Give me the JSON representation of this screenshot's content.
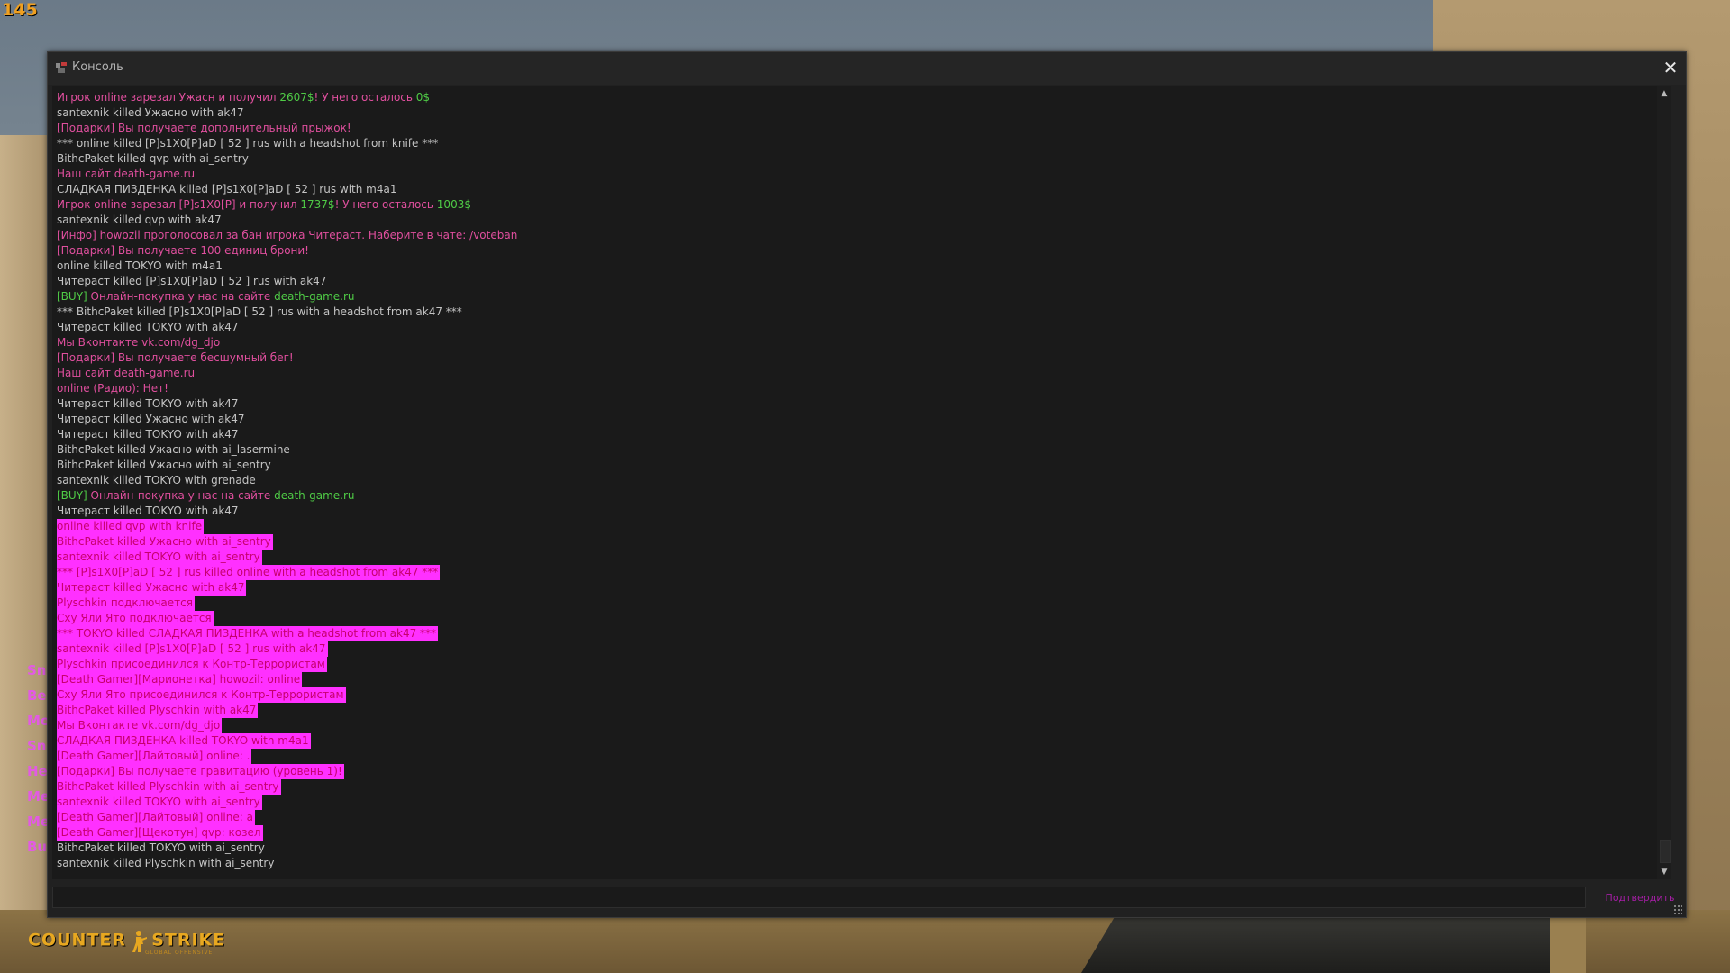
{
  "hud": {
    "fps": "145"
  },
  "side_chat": [
    "Sn",
    "Be",
    "Mo",
    "Sn",
    "He",
    "Me",
    "Me",
    "Bu"
  ],
  "console": {
    "title": "Консоль",
    "close_icon": "close-icon",
    "title_icon": "console-icon",
    "submit_label": "Подтвердить",
    "input_value": "",
    "colors": {
      "default": "#c4c4c4",
      "pink": "#e04f9e",
      "green": "#4fcb46",
      "highlight_bg": "#ff30ff",
      "highlight_fg": "#c7006f"
    },
    "lines": [
      {
        "segments": [
          {
            "t": "Игрок online зарезал Ужасн и получил ",
            "c": "pink"
          },
          {
            "t": "2607$",
            "c": "green"
          },
          {
            "t": "! У него осталось ",
            "c": "pink"
          },
          {
            "t": "0$",
            "c": "green"
          }
        ]
      },
      {
        "segments": [
          {
            "t": "santexnik killed Ужасно with ak47",
            "c": "default"
          }
        ]
      },
      {
        "segments": [
          {
            "t": "[Подарки] Вы получаете дополнительный прыжок!",
            "c": "pink"
          }
        ]
      },
      {
        "segments": [
          {
            "t": "*** online killed [P]s1X0[P]aD [ 52 ] rus with a headshot from knife ***",
            "c": "default"
          }
        ]
      },
      {
        "segments": [
          {
            "t": "BithcPaket killed qvp with ai_sentry",
            "c": "default"
          }
        ]
      },
      {
        "segments": [
          {
            "t": "Наш сайт death-game.ru",
            "c": "pink"
          }
        ]
      },
      {
        "segments": [
          {
            "t": "СЛАДКАЯ ПИЗДЕНКА killed [P]s1X0[P]aD [ 52 ] rus with m4a1",
            "c": "default"
          }
        ]
      },
      {
        "segments": [
          {
            "t": "Игрок online зарезал [P]s1X0[P] и получил ",
            "c": "pink"
          },
          {
            "t": "1737$",
            "c": "green"
          },
          {
            "t": "! У него осталось ",
            "c": "pink"
          },
          {
            "t": "1003$",
            "c": "green"
          }
        ]
      },
      {
        "segments": [
          {
            "t": "santexnik killed qvp with ak47",
            "c": "default"
          }
        ]
      },
      {
        "segments": [
          {
            "t": "[Инфо] howozil проголосовал за бан игрока Читераст. Наберите в чате: /voteban",
            "c": "pink"
          }
        ]
      },
      {
        "segments": [
          {
            "t": "[Подарки] Вы получаете 100 единиц брони!",
            "c": "pink"
          }
        ]
      },
      {
        "segments": [
          {
            "t": "online killed TOKYO with m4a1",
            "c": "default"
          }
        ]
      },
      {
        "segments": [
          {
            "t": "Читераст killed [P]s1X0[P]aD [ 52 ] rus with ak47",
            "c": "default"
          }
        ]
      },
      {
        "segments": [
          {
            "t": "[BUY] ",
            "c": "green"
          },
          {
            "t": "Онлайн-покупка у нас на сайте ",
            "c": "pink"
          },
          {
            "t": "death-game.ru",
            "c": "green"
          }
        ]
      },
      {
        "segments": [
          {
            "t": "*** BithcPaket killed [P]s1X0[P]aD [ 52 ] rus with a headshot from ak47 ***",
            "c": "default"
          }
        ]
      },
      {
        "segments": [
          {
            "t": "Читераст killed TOKYO with ak47",
            "c": "default"
          }
        ]
      },
      {
        "segments": [
          {
            "t": "Мы Вконтакте vk.com/dg_djo",
            "c": "pink"
          }
        ]
      },
      {
        "segments": [
          {
            "t": "[Подарки] Вы получаете бесшумный бег!",
            "c": "pink"
          }
        ]
      },
      {
        "segments": [
          {
            "t": "Наш сайт death-game.ru",
            "c": "pink"
          }
        ]
      },
      {
        "segments": [
          {
            "t": "online (Радио): Нет!",
            "c": "pink"
          }
        ]
      },
      {
        "segments": [
          {
            "t": "Читераст killed TOKYO with ak47",
            "c": "default"
          }
        ]
      },
      {
        "segments": [
          {
            "t": "Читераст killed Ужасно with ak47",
            "c": "default"
          }
        ]
      },
      {
        "segments": [
          {
            "t": "Читераст killed TOKYO with ak47",
            "c": "default"
          }
        ]
      },
      {
        "segments": [
          {
            "t": "BithcPaket killed Ужасно with ai_lasermine",
            "c": "default"
          }
        ]
      },
      {
        "segments": [
          {
            "t": "BithcPaket killed Ужасно with ai_sentry",
            "c": "default"
          }
        ]
      },
      {
        "segments": [
          {
            "t": "santexnik killed TOKYO with grenade",
            "c": "default"
          }
        ]
      },
      {
        "segments": [
          {
            "t": "[BUY] ",
            "c": "green"
          },
          {
            "t": "Онлайн-покупка у нас на сайте ",
            "c": "pink"
          },
          {
            "t": "death-game.ru",
            "c": "green"
          }
        ]
      },
      {
        "segments": [
          {
            "t": "Читераст killed TOKYO with ak47",
            "c": "default"
          }
        ]
      },
      {
        "highlight": true,
        "segments": [
          {
            "t": "online killed qvp with knife",
            "c": "hl"
          }
        ]
      },
      {
        "highlight": true,
        "segments": [
          {
            "t": "BithcPaket killed Ужасно with ai_sentry",
            "c": "hl"
          }
        ]
      },
      {
        "highlight": true,
        "segments": [
          {
            "t": "santexnik killed TOKYO with ai_sentry",
            "c": "hl"
          }
        ]
      },
      {
        "highlight": true,
        "segments": [
          {
            "t": "*** [P]s1X0[P]aD [ 52 ] rus killed online with a headshot from ak47 ***",
            "c": "hl"
          }
        ]
      },
      {
        "highlight": true,
        "segments": [
          {
            "t": "Читераст killed Ужасно with ak47",
            "c": "hl"
          }
        ]
      },
      {
        "highlight": true,
        "segments": [
          {
            "t": "Plyschkin подключается",
            "c": "hl"
          }
        ]
      },
      {
        "highlight": true,
        "segments": [
          {
            "t": "Сху Яли Ято подключается",
            "c": "hl"
          }
        ]
      },
      {
        "highlight": true,
        "segments": [
          {
            "t": "*** TOKYO killed СЛАДКАЯ ПИЗДЕНКА with a headshot from ak47 ***",
            "c": "hl"
          }
        ]
      },
      {
        "highlight": true,
        "segments": [
          {
            "t": "santexnik killed [P]s1X0[P]aD [ 52 ] rus with ak47",
            "c": "hl"
          }
        ]
      },
      {
        "highlight": true,
        "segments": [
          {
            "t": "Plyschkin присоединился к Контр-Террористам",
            "c": "hl"
          }
        ]
      },
      {
        "highlight": true,
        "segments": [
          {
            "t": "[Death Gamer][Марионетка] howozil: online",
            "c": "hl"
          }
        ]
      },
      {
        "highlight": true,
        "segments": [
          {
            "t": "Сху Яли Ято присоединился к Контр-Террористам",
            "c": "hl"
          }
        ]
      },
      {
        "highlight": true,
        "segments": [
          {
            "t": "BithcPaket killed Plyschkin with ak47",
            "c": "hl"
          }
        ]
      },
      {
        "highlight": true,
        "segments": [
          {
            "t": "Мы Вконтакте vk.com/dg_djo",
            "c": "hl"
          }
        ]
      },
      {
        "highlight": true,
        "segments": [
          {
            "t": "СЛАДКАЯ ПИЗДЕНКА killed TOKYO with m4a1",
            "c": "hl"
          }
        ]
      },
      {
        "highlight": true,
        "segments": [
          {
            "t": "[Death Gamer][Лайтовый] online: .",
            "c": "hl"
          }
        ]
      },
      {
        "highlight": true,
        "segments": [
          {
            "t": "[Подарки] Вы получаете гравитацию (уровень 1)!",
            "c": "hl"
          }
        ]
      },
      {
        "highlight": true,
        "segments": [
          {
            "t": "BithcPaket killed Plyschkin with ai_sentry",
            "c": "hl"
          }
        ]
      },
      {
        "highlight": true,
        "segments": [
          {
            "t": "santexnik killed TOKYO with ai_sentry",
            "c": "hl"
          }
        ]
      },
      {
        "highlight": true,
        "segments": [
          {
            "t": "[Death Gamer][Лайтовый] online: а",
            "c": "hl"
          }
        ]
      },
      {
        "highlight": true,
        "segments": [
          {
            "t": "[Death Gamer][Щекотун] qvp: козел",
            "c": "hl"
          }
        ]
      },
      {
        "segments": [
          {
            "t": "BithcPaket killed TOKYO with ai_sentry",
            "c": "default"
          }
        ]
      },
      {
        "segments": [
          {
            "t": "santexnik killed Plyschkin with ai_sentry",
            "c": "default"
          }
        ]
      }
    ]
  },
  "logo": {
    "left": "COUNTER",
    "right": "STRIKE",
    "sub": "GLOBAL OFFENSIVE"
  }
}
